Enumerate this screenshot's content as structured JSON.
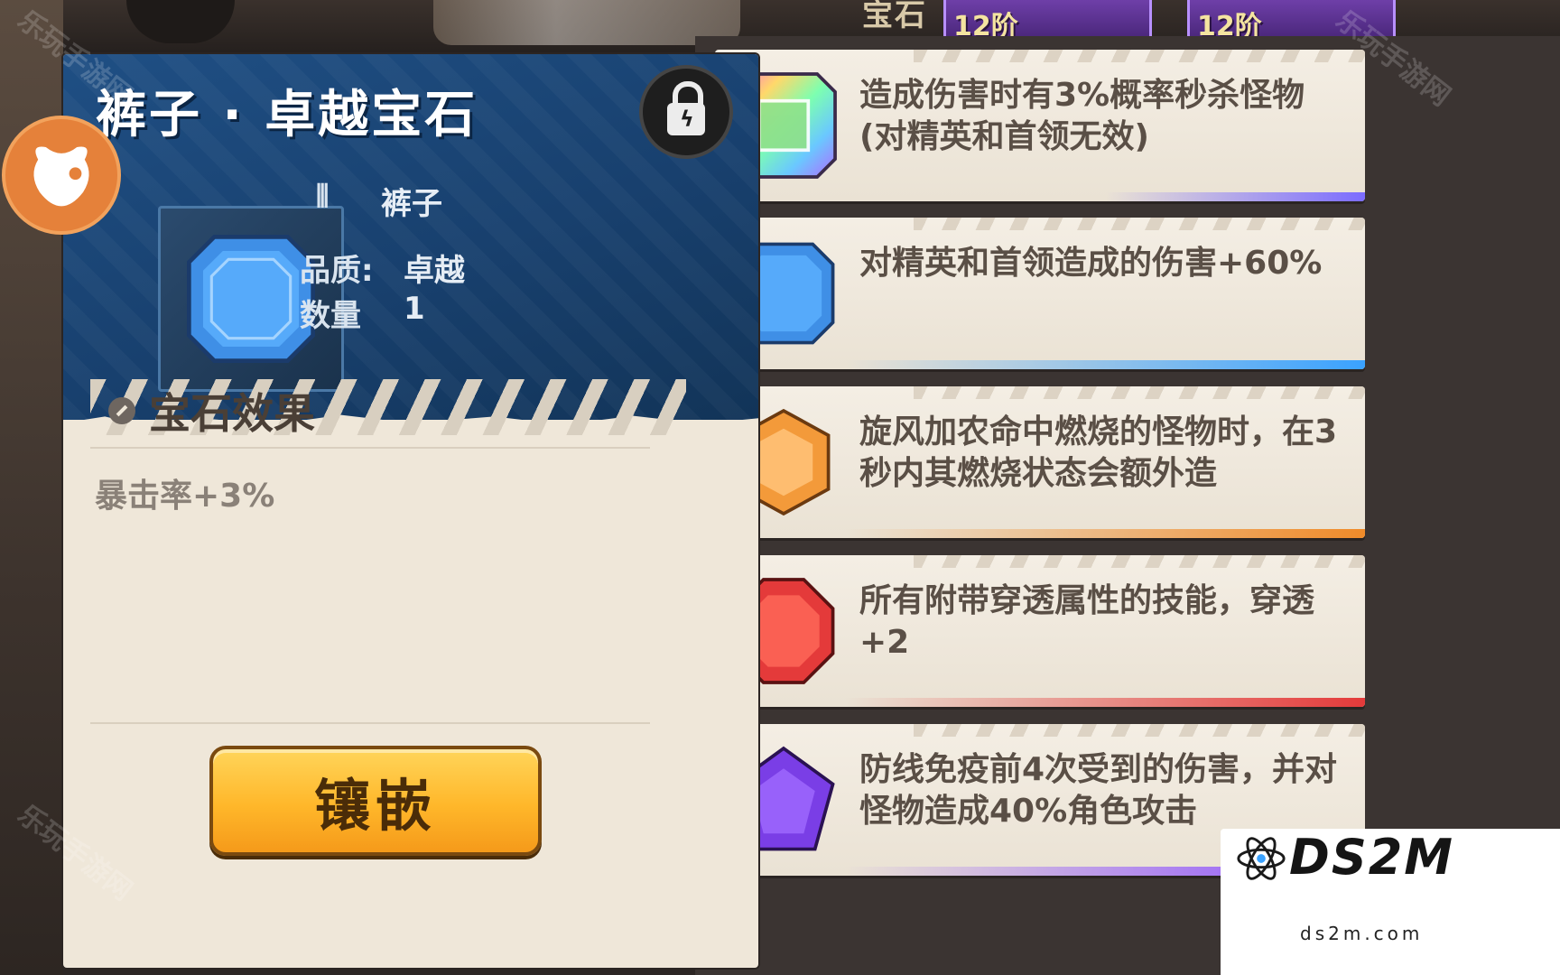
{
  "top": {
    "label": "宝石",
    "tiers": [
      "12阶",
      "12阶"
    ]
  },
  "detail": {
    "title": "裤子 · 卓越宝石",
    "slot_value": "裤子",
    "quality_label": "品质:",
    "quality_value": "卓越",
    "count_label": "数量",
    "count_value": "1",
    "effect_title": "宝石效果",
    "effect_text": "暴击率+3%",
    "inlay_button": "镶嵌",
    "icons": {
      "lock": "lock-icon",
      "slot": "pants-icon",
      "effect": "effect-icon",
      "ox": "ox-icon"
    }
  },
  "gem_list": [
    {
      "text": "造成伤害时有3%概率秒杀怪物(对精英和首领无效)",
      "color": "rainbow",
      "accent": "#7b6cff"
    },
    {
      "text": "对精英和首领造成的伤害+60%",
      "color": "#3f8fe6",
      "accent": "#3aa2ff"
    },
    {
      "text": "旋风加农命中燃烧的怪物时，在3秒内其燃烧状态会额外造",
      "color": "#f39a3a",
      "accent": "#f08b2a"
    },
    {
      "text": "所有附带穿透属性的技能，穿透+2",
      "color": "#e43a3a",
      "accent": "#e43a3a"
    },
    {
      "text": "防线免疫前4次受到的伤害，并对怪物造成40%角色攻击",
      "color": "#7a3ee6",
      "accent": "#8a4cff"
    }
  ],
  "watermark": "乐玩手游网",
  "logo": {
    "main": "DS2M",
    "sub": "ds2m.com"
  }
}
